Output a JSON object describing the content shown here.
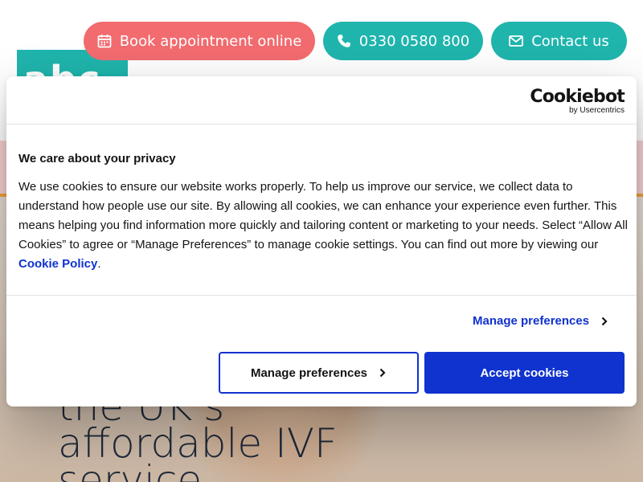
{
  "header": {
    "book_label": "Book appointment online",
    "phone_label": "0330 0580 800",
    "contact_label": "Contact us",
    "logo_text": "abc"
  },
  "hero": {
    "title_lines": [
      "the UK's",
      "affordable IVF",
      "service"
    ]
  },
  "cookie_dialog": {
    "brand": "Cookiebot",
    "brand_sub": "by Usercentrics",
    "title": "We care about your privacy",
    "body_text": "We use cookies to ensure our website works properly. To help us improve our service, we collect data to understand how people use our site. By allowing all cookies, we can enhance your experience even further. This means helping you find information more quickly and tailoring content or marketing to your needs. Select “Allow All Cookies” to agree or “Manage Preferences” to manage cookie settings. You can find out more by viewing our",
    "policy_link": "Cookie Policy",
    "body_end": ".",
    "manage_link_label": "Manage preferences",
    "manage_button_label": "Manage preferences",
    "accept_button_label": "Accept cookies"
  },
  "colors": {
    "coral": "#f26b6f",
    "teal": "#1fb5ad",
    "cookie_blue": "#1032cf"
  },
  "icons": {
    "book": "calendar-icon",
    "phone": "phone-icon",
    "contact": "envelope-icon",
    "chevron": "chevron-right-icon"
  }
}
